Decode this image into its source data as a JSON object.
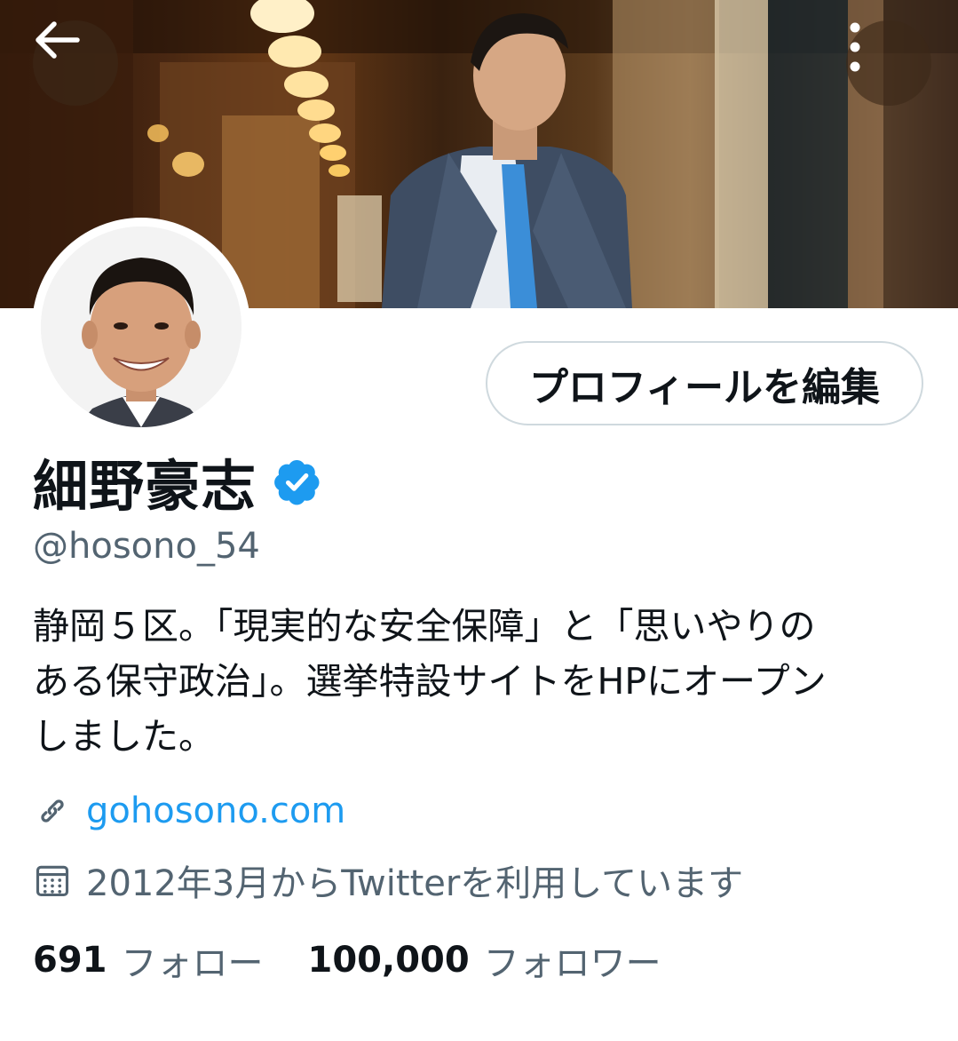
{
  "header": {
    "back_icon": "arrow-left-icon",
    "more_icon": "more-vertical-icon"
  },
  "profile": {
    "edit_button_label": "プロフィールを編集",
    "display_name": "細野豪志",
    "verified_icon": "verified-badge-icon",
    "verified_color": "#1d9bf0",
    "handle": "@hosono_54",
    "bio_lines": [
      "静岡５区。「現実的な安全保障」と「思いやりの",
      "ある保守政治」。選挙特設サイトをHPにオープン",
      "しました。"
    ],
    "link_icon": "link-icon",
    "link_text": "gohosono.com",
    "link_color": "#1d9bf0",
    "joined_icon": "calendar-icon",
    "joined_text": "2012年3月からTwitterを利用しています"
  },
  "stats": {
    "following_count": "691",
    "following_label": "フォロー",
    "followers_count": "100,000",
    "followers_label": "フォロワー"
  }
}
